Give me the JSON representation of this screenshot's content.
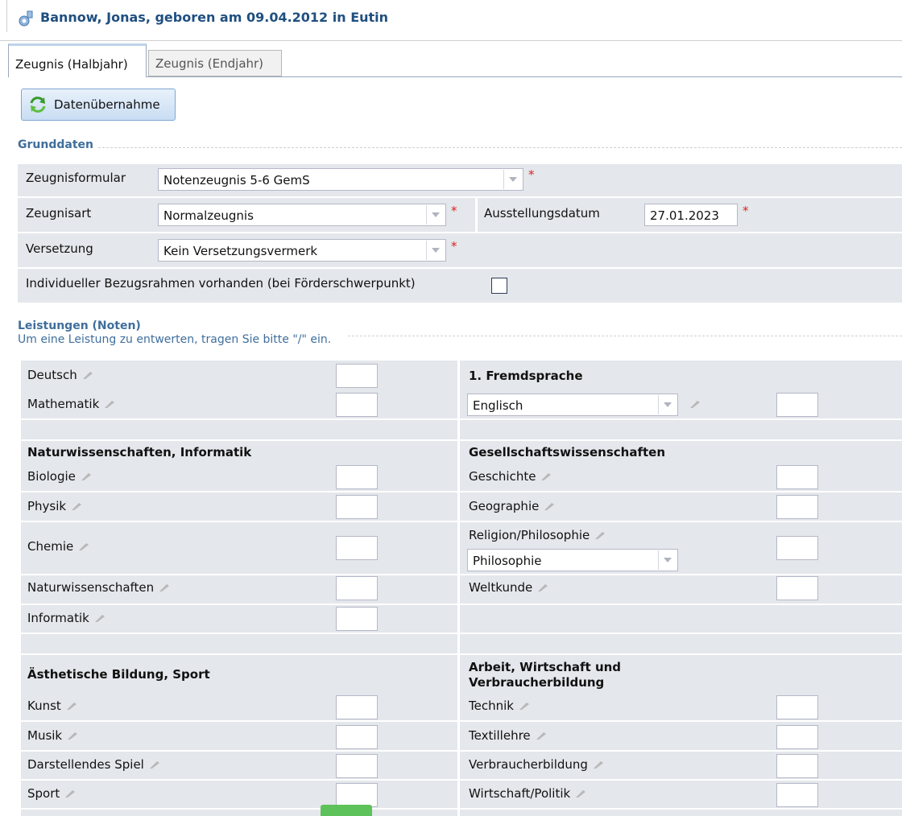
{
  "header": {
    "title": "Bannow, Jonas, geboren am 09.04.2012 in Eutin"
  },
  "tabs": [
    {
      "label": "Zeugnis (Halbjahr)",
      "active": true
    },
    {
      "label": "Zeugnis (Endjahr)",
      "active": false
    }
  ],
  "toolbar": {
    "import_label": "Datenübernahme"
  },
  "grunddaten": {
    "legend": "Grunddaten",
    "zeugnisformular": {
      "label": "Zeugnisformular",
      "value": "Notenzeugnis 5-6 GemS"
    },
    "zeugnisart": {
      "label": "Zeugnisart",
      "value": "Normalzeugnis"
    },
    "ausstellungsdatum": {
      "label": "Ausstellungsdatum",
      "value": "27.01.2023"
    },
    "versetzung": {
      "label": "Versetzung",
      "value": "Kein Versetzungsvermerk"
    },
    "bezugsrahmen": {
      "label": "Individueller Bezugsrahmen vorhanden (bei Förderschwerpunkt)",
      "checked": false
    },
    "required_mark": "*"
  },
  "leistungen": {
    "legend": "Leistungen (Noten)",
    "hint": "Um eine Leistung zu entwerten, tragen Sie bitte \"/\" ein.",
    "left": {
      "deutsch": "Deutsch",
      "mathematik": "Mathematik",
      "nawi_heading": "Naturwissenschaften, Informatik",
      "biologie": "Biologie",
      "physik": "Physik",
      "chemie": "Chemie",
      "naturwissenschaften": "Naturwissenschaften",
      "informatik": "Informatik",
      "aesthetik_heading": "Ästhetische Bildung, Sport",
      "kunst": "Kunst",
      "musik": "Musik",
      "darstellendes_spiel": "Darstellendes Spiel",
      "sport": "Sport"
    },
    "right": {
      "fremdsprache_heading": "1. Fremdsprache",
      "fremdsprache_value": "Englisch",
      "gesellschaft_heading": "Gesellschaftswissenschaften",
      "geschichte": "Geschichte",
      "geographie": "Geographie",
      "religion": "Religion/Philosophie",
      "religion_value": "Philosophie",
      "weltkunde": "Weltkunde",
      "arbeit_heading_1": "Arbeit, Wirtschaft und",
      "arbeit_heading_2": "Verbraucherbildung",
      "technik": "Technik",
      "textillehre": "Textillehre",
      "verbraucherbildung": "Verbraucherbildung",
      "wirtschaft_politik": "Wirtschaft/Politik"
    }
  },
  "colors": {
    "accent": "#1f4f80",
    "legend": "#3f6e9c",
    "row": "#e4e7eb",
    "required": "#e02020"
  }
}
